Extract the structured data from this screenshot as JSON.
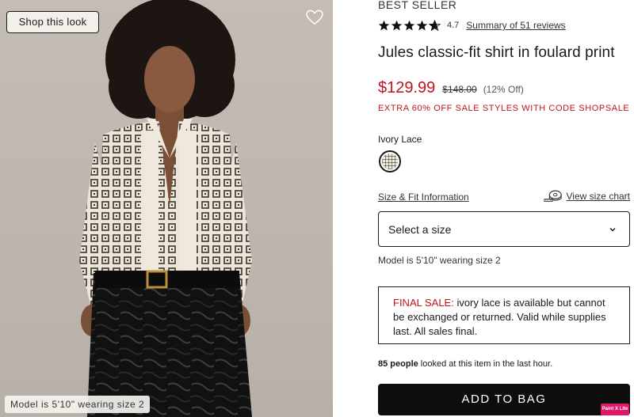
{
  "hero": {
    "shop_button": "Shop this look",
    "model_caption": "Model is 5'10\" wearing size 2",
    "heart_icon": "heart-outline-icon"
  },
  "product": {
    "badge": "BEST SELLER",
    "rating_value": "4.7",
    "rating_stars": 4.7,
    "reviews_link": "Summary of 51 reviews",
    "title": "Jules classic-fit shirt in foulard print",
    "price_sale": "$129.99",
    "price_original": "$148.00",
    "price_discount": "(12% Off)",
    "promo": "EXTRA 60% OFF SALE STYLES WITH CODE SHOPSALE",
    "color_name": "Ivory Lace",
    "size_fit_link": "Size & Fit Information",
    "size_chart_link": "View size chart",
    "size_chart_icon": "tape-measure-icon",
    "size_select_label": "Select a size",
    "model_note": "Model is 5'10\" wearing size 2",
    "final_sale_label": "FINAL SALE:",
    "final_sale_text": " ivory lace is available but cannot be exchanged or returned. Valid while supplies last. All sales final.",
    "viewers_count": "85 people",
    "viewers_text": " looked at this item in the last hour.",
    "add_to_bag": "ADD TO BAG"
  },
  "overlay_badge": "Paint X Lite",
  "colors": {
    "sale_red": "#c0141d",
    "button_black": "#0d0d0d",
    "badge_pink": "#e0186c"
  }
}
